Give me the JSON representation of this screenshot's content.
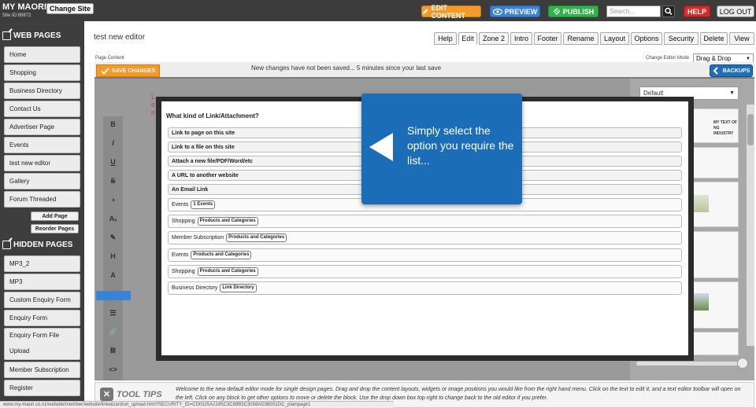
{
  "topbar": {
    "site_name": "MY MAORI",
    "site_id": "Site ID:89872",
    "change_site": "Change Site",
    "edit_content": "EDIT CONTENT",
    "preview": "PREVIEW",
    "publish": "PUBLISH",
    "search_placeholder": "Search...",
    "help": "HELP",
    "logout": "LOG OUT"
  },
  "sidebar": {
    "web_pages_heading": "WEB PAGES",
    "web_pages": [
      "Home",
      "Shopping",
      "Business Directory",
      "Contact Us",
      "Advertiser Page",
      "Events",
      "test new editor",
      "Gallery",
      "Forum Threaded"
    ],
    "add_page": "Add Page",
    "reorder_pages": "Reorder Pages",
    "hidden_pages_heading": "HIDDEN PAGES",
    "hidden_pages": [
      "MP3_2",
      "MP3",
      "Custom Enquiry Form",
      "Enquiry Form"
    ],
    "enquiry_form_file": [
      "Enquiry Form File",
      "Upload"
    ],
    "hidden_pages_after": [
      "Member Subscription",
      "Register"
    ]
  },
  "main": {
    "page_title": "test new editor",
    "tabs": [
      "Help",
      "Edit",
      "Zone 2",
      "Intro",
      "Footer",
      "Rename",
      "Layout",
      "Options",
      "Security",
      "Delete",
      "View"
    ],
    "active_tab": "Edit",
    "page_content_label": "Page Content",
    "change_mode_label": "Change Editor Mode",
    "mode_value": "Drag & Drop",
    "save_changes": "SAVE CHANGES",
    "notice": "New changes have not been saved... 5 minutes since your last save",
    "backups": "BACKUPS"
  },
  "formatting_toolbar": [
    "B",
    "I",
    "U",
    "S",
    "◑",
    "Aₓ",
    "✎",
    "H",
    "A",
    "≡",
    "☰",
    "🔗",
    "⛓",
    "<>"
  ],
  "right_panel": {
    "select_value": "Default",
    "thumb_text": [
      "MY TEXT OF",
      "NG INDUSTRY"
    ]
  },
  "modal": {
    "question": "What kind of Link/Attachment?",
    "options_bold": [
      "Link to page on this site",
      "Link to a file on this site",
      "Attach a new file/PDF/Word/etc",
      "A URL to another website",
      "An Email Link"
    ],
    "options_chip": [
      {
        "label": "Events",
        "chip": "1 Events"
      },
      {
        "label": "Shopping",
        "chip": "Products and Categories"
      },
      {
        "label": "Member Subscription",
        "chip": "Products and Categories"
      },
      {
        "label": "Events",
        "chip": "Products and Categories"
      },
      {
        "label": "Shopping",
        "chip": "Products and Categories"
      },
      {
        "label": "Business Directory",
        "chip": "Link Directory"
      }
    ]
  },
  "tooltip": {
    "text": "Simply select the option you require the list..."
  },
  "tips": {
    "logo": "TOOL TIPS",
    "text": "Welcome to the new default editor mode for single design pages. Drag and drop the content layouts, widgets or image positions you would like from the right hand menu. Click on the text to edit it, and a text editor toolbar will open on the left. Click on any block to get other options to move or delete the block. Use the drop down box top right to change back to the old editor if you prefer."
  },
  "statusbar": "www.my-maori.co.nz/website/member/website/linkwizard/url_upload.html?SECURITY_ID=CD0325A2185C3C88B3C3058AD3B051DC_plainpage1",
  "colors": {
    "orange": "#f39a2a",
    "blue": "#1b6db8",
    "green": "#2fb24a",
    "red": "#d62b2b",
    "dark": "#3e3e3e"
  }
}
